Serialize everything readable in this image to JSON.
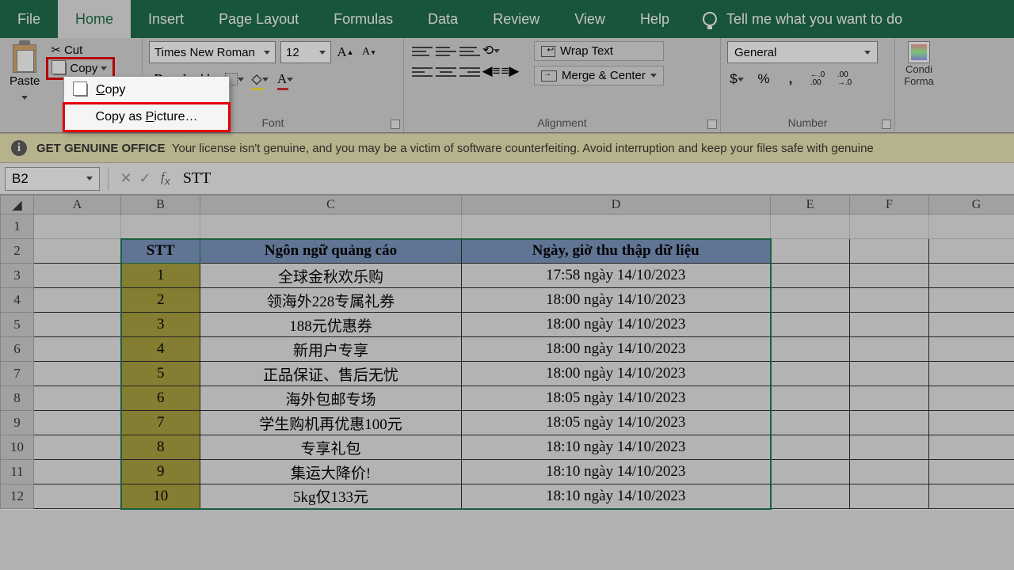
{
  "tabs": {
    "file": "File",
    "home": "Home",
    "insert": "Insert",
    "pagelayout": "Page Layout",
    "formulas": "Formulas",
    "data": "Data",
    "review": "Review",
    "view": "View",
    "help": "Help",
    "tellme": "Tell me what you want to do"
  },
  "clipboard": {
    "paste": "Paste",
    "cut": "Cut",
    "copy": "Copy",
    "menu_copy": "Copy",
    "menu_copy_as_picture": "Copy as Picture…"
  },
  "font": {
    "name": "Times New Roman",
    "size": "12",
    "group": "Font",
    "bold": "B",
    "italic": "I",
    "underline": "U"
  },
  "alignment": {
    "group": "Alignment",
    "wrap": "Wrap Text",
    "merge": "Merge & Center"
  },
  "number": {
    "group": "Number",
    "format": "General",
    "currency": "$",
    "percent": "%",
    "comma": ",",
    "inc": "←.0\n.00",
    "dec": ".00\n→.0"
  },
  "cond": {
    "l1": "Condi",
    "l2": "Forma"
  },
  "msg": {
    "title": "GET GENUINE OFFICE",
    "body": "Your license isn't genuine, and you may be a victim of software counterfeiting. Avoid interruption and keep your files safe with genuine"
  },
  "namebox": "B2",
  "fxvalue": "STT",
  "columns": [
    "A",
    "B",
    "C",
    "D",
    "E",
    "F",
    "G"
  ],
  "rows": [
    "1",
    "2",
    "3",
    "4",
    "5",
    "6",
    "7",
    "8",
    "9",
    "10",
    "11",
    "12"
  ],
  "headers": {
    "b": "STT",
    "c": "Ngôn ngữ quảng cáo",
    "d": "Ngày, giờ thu thập dữ liệu"
  },
  "datarows": [
    {
      "stt": "1",
      "c": "全球金秋欢乐购",
      "d": "17:58 ngày 14/10/2023"
    },
    {
      "stt": "2",
      "c": "领海外228专属礼券",
      "d": "18:00 ngày 14/10/2023"
    },
    {
      "stt": "3",
      "c": "188元优惠券",
      "d": "18:00 ngày 14/10/2023"
    },
    {
      "stt": "4",
      "c": "新用户专享",
      "d": "18:00 ngày 14/10/2023"
    },
    {
      "stt": "5",
      "c": "正品保证、售后无忧",
      "d": "18:00 ngày 14/10/2023"
    },
    {
      "stt": "6",
      "c": "海外包邮专场",
      "d": "18:05 ngày 14/10/2023"
    },
    {
      "stt": "7",
      "c": "学生购机再优惠100元",
      "d": "18:05 ngày 14/10/2023"
    },
    {
      "stt": "8",
      "c": "专享礼包",
      "d": "18:10 ngày 14/10/2023"
    },
    {
      "stt": "9",
      "c": "集运大降价!",
      "d": "18:10 ngày 14/10/2023"
    },
    {
      "stt": "10",
      "c": "5kg仅133元",
      "d": "18:10 ngày 14/10/2023"
    }
  ]
}
